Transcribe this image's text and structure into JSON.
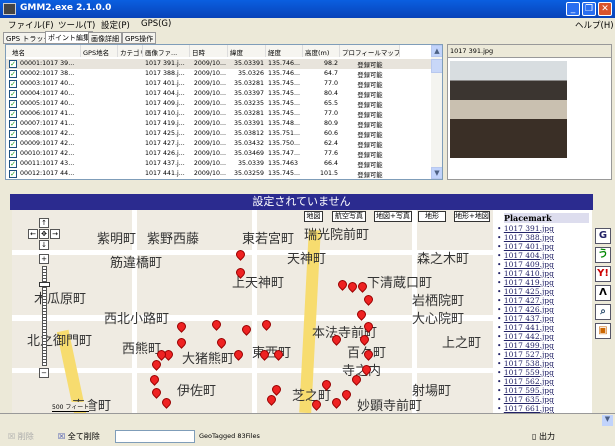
{
  "window": {
    "title": "GMM2.exe 2.1.0.0"
  },
  "menu": [
    {
      "label": "ファイル(F)"
    },
    {
      "label": "ツール(T)"
    },
    {
      "label": "設定(P)"
    },
    {
      "label": "GPS(G)"
    },
    {
      "label": "ヘルプ(H)"
    }
  ],
  "tabs": [
    {
      "label": "GPS トラック"
    },
    {
      "label": "ポイント編集",
      "active": true
    },
    {
      "label": "画像詳細"
    },
    {
      "label": "GPS操作"
    }
  ],
  "grid": {
    "columns": [
      "地名",
      "GPS地名",
      "カテゴリ",
      "画像ファ...",
      "日時",
      "緯度",
      "経度",
      "高度(m)",
      "プロフィールマップ"
    ],
    "rows": [
      [
        "00001:1017 39...",
        "",
        "",
        "1017 391.j...",
        "2009/10...",
        "35.03391",
        "135.746...",
        "98.2",
        "登録可能"
      ],
      [
        "00002:1017 38...",
        "",
        "",
        "1017 388.j...",
        "2009/10...",
        "35.0326",
        "135.746...",
        "64.7",
        "登録可能"
      ],
      [
        "00003:1017 40...",
        "",
        "",
        "1017 401.j...",
        "2009/10...",
        "35.03281",
        "135.745...",
        "77.0",
        "登録可能"
      ],
      [
        "00004:1017 40...",
        "",
        "",
        "1017 404.j...",
        "2009/10...",
        "35.03397",
        "135.745...",
        "80.4",
        "登録可能"
      ],
      [
        "00005:1017 40...",
        "",
        "",
        "1017 409.j...",
        "2009/10...",
        "35.03235",
        "135.745...",
        "65.5",
        "登録可能"
      ],
      [
        "00006:1017 41...",
        "",
        "",
        "1017 410.j...",
        "2009/10...",
        "35.03281",
        "135.745...",
        "77.0",
        "登録可能"
      ],
      [
        "00007:1017 41...",
        "",
        "",
        "1017 419.j...",
        "2009/10...",
        "35.03391",
        "135.748...",
        "80.9",
        "登録可能"
      ],
      [
        "00008:1017 42...",
        "",
        "",
        "1017 425.j...",
        "2009/10...",
        "35.03812",
        "135.751...",
        "60.6",
        "登録可能"
      ],
      [
        "00009:1017 42...",
        "",
        "",
        "1017 427.j...",
        "2009/10...",
        "35.03432",
        "135.750...",
        "62.4",
        "登録可能"
      ],
      [
        "00010:1017 42...",
        "",
        "",
        "1017 426.j...",
        "2009/10...",
        "35.03469",
        "135.747...",
        "77.6",
        "登録可能"
      ],
      [
        "00011:1017 43...",
        "",
        "",
        "1017 437.j...",
        "2009/10...",
        "35.0339",
        "135.7463",
        "66.4",
        "登録可能"
      ],
      [
        "00012:1017 44...",
        "",
        "",
        "1017 441.j...",
        "2009/10...",
        "35.03259",
        "135.745...",
        "101.5",
        "登録可能"
      ]
    ]
  },
  "image_panel": {
    "caption": "1017 391.jpg"
  },
  "map": {
    "header": "設定されていません",
    "types": [
      "地図",
      "航空写真",
      "地図+写真",
      "地形",
      "地形+地図"
    ],
    "labels": [
      "紫明町",
      "紫野西藤",
      "東若宮町",
      "天神町",
      "森之木町",
      "筋違橋町",
      "上天神町",
      "下清蔵口町",
      "岩栖院町",
      "木瓜原町",
      "西北小路町",
      "大心院町",
      "本法寺前町",
      "西熊町",
      "大猪熊町",
      "東西町",
      "百々町",
      "寺之内",
      "伊佐町",
      "射場町",
      "芝之町",
      "妙顕寺前町",
      "真倉町",
      "北之御門町",
      "上之町",
      "瑞光院前町"
    ],
    "scale": "500 フィート"
  },
  "placemark": {
    "title": "Placemark",
    "items": [
      "1017 391.jpg",
      "1017 388.jpg",
      "1017 401.jpg",
      "1017 404.jpg",
      "1017 409.jpg",
      "1017 410.jpg",
      "1017 419.jpg",
      "1017 425.jpg",
      "1017 427.jpg",
      "1017 426.jpg",
      "1017 437.jpg",
      "1017 441.jpg",
      "1017 442.jpg",
      "1017 499.jpg",
      "1017 527.jpg",
      "1017 538.jpg",
      "1017 559.jpg",
      "1017 562.jpg",
      "1017 595.jpg",
      "1017 635.jpg",
      "1017 661.jpg"
    ]
  },
  "right_tools": [
    {
      "icon": "google-icon",
      "glyph": "G"
    },
    {
      "icon": "goo-icon",
      "glyph": "う"
    },
    {
      "icon": "yahoo-icon",
      "glyph": "Y!"
    },
    {
      "icon": "mountain-icon",
      "glyph": "Λ"
    },
    {
      "icon": "zoom-view-icon",
      "glyph": "⌕"
    },
    {
      "icon": "camera-bag-icon",
      "glyph": "▣"
    }
  ],
  "bottom": {
    "delete_label": "削除",
    "delete_all_label": "全て削除",
    "input_value": "",
    "status": "GeoTagged 83Files",
    "output_label": "出力"
  }
}
